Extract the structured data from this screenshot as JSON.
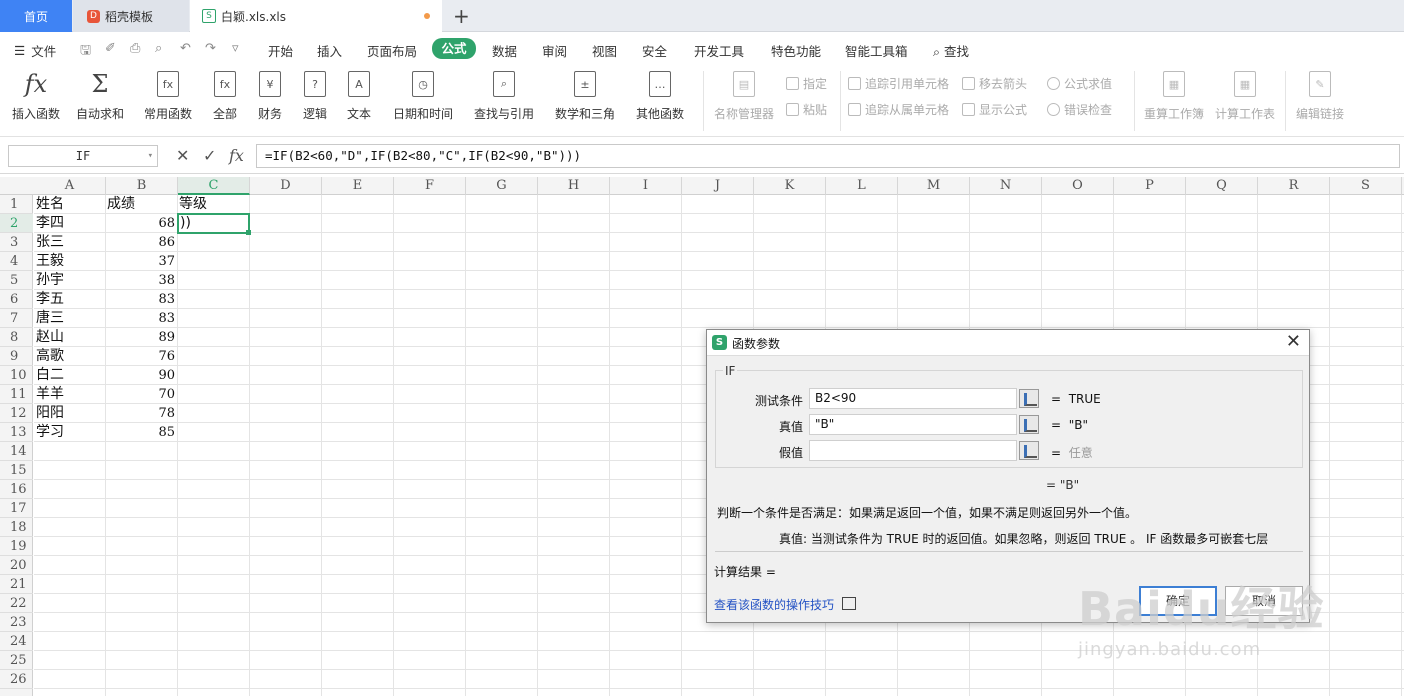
{
  "tabs": {
    "home": "首页",
    "template": "稻壳模板",
    "file": "白颖.xls.xls",
    "new": "+"
  },
  "menu": {
    "file": "文件",
    "items": [
      "开始",
      "插入",
      "页面布局",
      "公式",
      "数据",
      "审阅",
      "视图",
      "安全",
      "开发工具",
      "特色功能",
      "智能工具箱"
    ],
    "search": "查找"
  },
  "ribbon": {
    "insert_fn": "插入函数",
    "autosum": "自动求和",
    "common": "常用函数",
    "all": "全部",
    "finance": "财务",
    "logic": "逻辑",
    "text": "文本",
    "datetime": "日期和时间",
    "lookup": "查找与引用",
    "math": "数学和三角",
    "other": "其他函数",
    "name_mgr": "名称管理器",
    "define": "指定",
    "paste": "粘贴",
    "trace_prec": "追踪引用单元格",
    "trace_dep": "追踪从属单元格",
    "remove_arrows": "移去箭头",
    "show_formula": "显示公式",
    "eval": "公式求值",
    "err_check": "错误检查",
    "recalc_wb": "重算工作簿",
    "calc_ws": "计算工作表",
    "edit_links": "编辑链接"
  },
  "formula_bar": {
    "name_box": "IF",
    "cancel": "✕",
    "confirm": "✓",
    "fx": "fx",
    "formula": "=IF(B2<60,\"D\",IF(B2<80,\"C\",IF(B2<90,\"B\")))"
  },
  "columns": [
    "A",
    "B",
    "C",
    "D",
    "E",
    "F",
    "G",
    "H",
    "I",
    "J",
    "K",
    "L",
    "M",
    "N",
    "O",
    "P",
    "Q",
    "R",
    "S"
  ],
  "rows": [
    "1",
    "2",
    "3",
    "4",
    "5",
    "6",
    "7",
    "8",
    "9",
    "10",
    "11",
    "12",
    "13",
    "14",
    "15",
    "16",
    "17",
    "18",
    "19",
    "20",
    "21",
    "22",
    "23",
    "24",
    "25",
    "26"
  ],
  "sheet": {
    "headers": [
      "姓名",
      "成绩",
      "等级"
    ],
    "names": [
      "李四",
      "张三",
      "王毅",
      "孙宇",
      "李五",
      "唐三",
      "赵山",
      "高歌",
      "白二",
      "羊羊",
      "阳阳",
      "学习"
    ],
    "scores": [
      "68",
      "86",
      "37",
      "38",
      "83",
      "83",
      "89",
      "76",
      "90",
      "70",
      "78",
      "85"
    ],
    "c2": "))"
  },
  "dialog": {
    "title": "函数参数",
    "group": "IF",
    "params": [
      {
        "label": "测试条件",
        "value": "B2<90",
        "result": "TRUE"
      },
      {
        "label": "真值",
        "value": "\"B\"",
        "result": "\"B\""
      },
      {
        "label": "假值",
        "value": "",
        "result": "任意"
      }
    ],
    "eq": "=",
    "value": "= \"B\"",
    "desc": "判断一个条件是否满足：如果满足返回一个值，如果不满足则返回另外一个值。",
    "param_desc": "真值:   当测试条件为 TRUE 时的返回值。如果忽略，则返回 TRUE 。 IF 函数最多可嵌套七层",
    "calc": "计算结果  =",
    "link": "查看该函数的操作技巧",
    "ok": "确定",
    "cancel": "取消"
  },
  "watermark": {
    "logo": "Baidu经验",
    "url": "jingyan.baidu.com"
  },
  "colors": {
    "accent": "#2fa36b",
    "tab_blue": "#3f83f4"
  }
}
